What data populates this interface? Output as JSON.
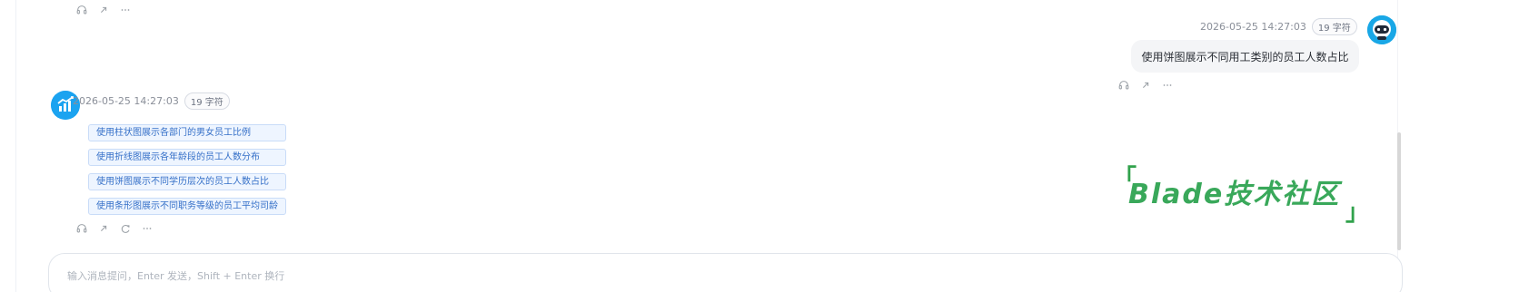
{
  "top_actions": {
    "items": [
      "headphones-icon",
      "share-icon",
      "more-icon"
    ]
  },
  "user_message": {
    "timestamp": "2026-05-25 14:27:03",
    "count_badge": "19 字符",
    "text": "使用饼图展示不同用工类别的员工人数占比",
    "actions": [
      "headphones-icon",
      "share-icon",
      "more-icon"
    ]
  },
  "assistant_message": {
    "timestamp": "2026-05-25 14:27:03",
    "count_badge": "19 字符",
    "suggestions": [
      "使用柱状图展示各部门的男女员工比例",
      "使用折线图展示各年龄段的员工人数分布",
      "使用饼图展示不同学历层次的员工人数占比",
      "使用条形图展示不同职务等级的员工平均司龄"
    ],
    "actions": [
      "headphones-icon",
      "share-icon",
      "refresh-icon",
      "more-icon"
    ]
  },
  "watermark": {
    "text": "Blade技术社区",
    "left_bracket": "「",
    "right_bracket": "」"
  },
  "input": {
    "placeholder": "输入消息提问，Enter 发送，Shift + Enter 换行"
  },
  "colors": {
    "accent_blue": "#1ba3f0",
    "suggestion_border": "#c9dcf8",
    "suggestion_bg": "#eef5ff",
    "suggestion_text": "#3570c8",
    "watermark_green": "#39a85a"
  }
}
